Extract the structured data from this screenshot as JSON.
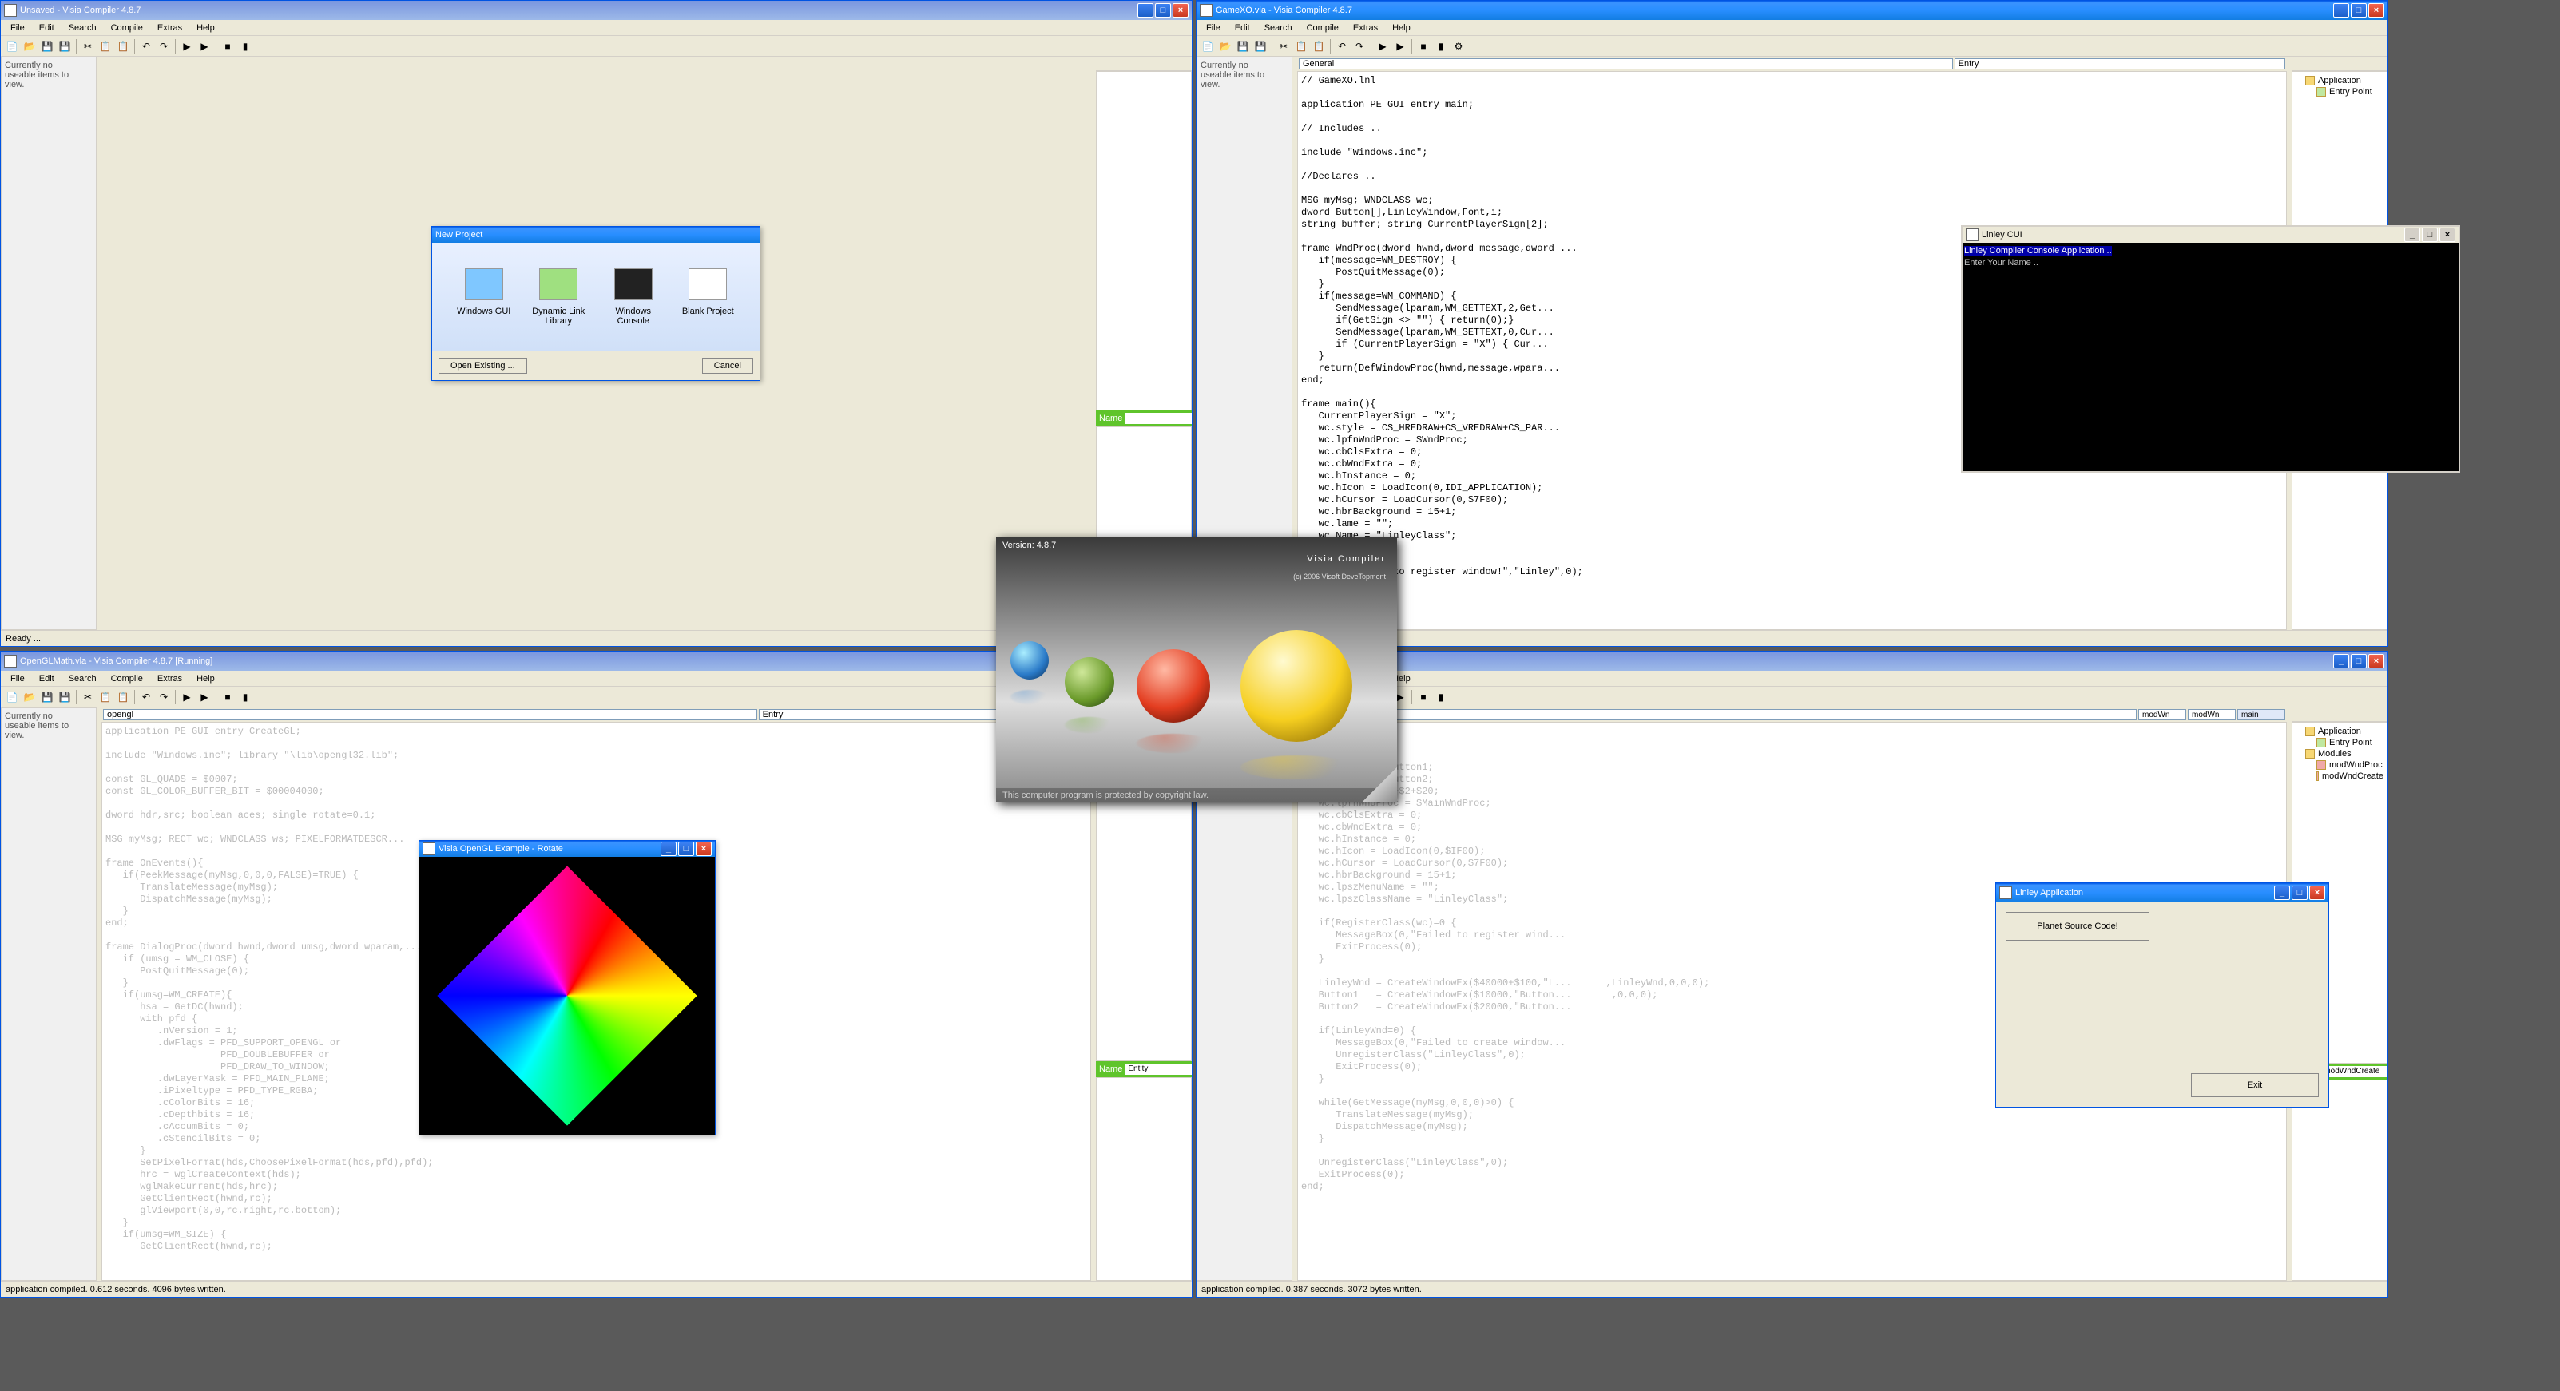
{
  "windows": {
    "w1": {
      "title": "Unsaved - Visia Compiler 4.8.7",
      "status": "Ready ..."
    },
    "w2": {
      "title": "GameXO.vla - Visia Compiler 4.8.7",
      "status": ""
    },
    "w3": {
      "title": "OpenGLMath.vla - Visia Compiler 4.8.7 [Running]",
      "status": "application compiled. 0.612 seconds. 4096 bytes written."
    },
    "w4": {
      "title": "",
      "status": "application compiled. 0.387 seconds. 3072 bytes written."
    }
  },
  "menu": [
    "File",
    "Edit",
    "Search",
    "Compile",
    "Extras",
    "Help"
  ],
  "leftpanel": "Currently no\nuseable items to\nview.",
  "combo": {
    "general": "General",
    "entry": "Entry"
  },
  "newproject": {
    "title": "New Project",
    "types": [
      "Windows GUI",
      "Dynamic Link Library",
      "Windows Console",
      "Blank Project"
    ],
    "open": "Open Existing ...",
    "cancel": "Cancel"
  },
  "console": {
    "title": "Linley CUI",
    "line1": "Linley Compiler Console Application ..",
    "line2": "Enter Your Name .."
  },
  "gl": {
    "title": "Visia OpenGL Example - Rotate"
  },
  "linley": {
    "title": "Linley Application",
    "btn1": "Planet Source Code!",
    "btn2": "Exit"
  },
  "splash": {
    "version": "Version: 4.8.7",
    "name": "Visia Compiler",
    "sub": "(c) 2006 Visoft DeveTopment",
    "foot": "This computer program is protected by copyright law."
  },
  "tree2": {
    "app": "Application",
    "ep": "Entry Point"
  },
  "tree4": {
    "app": "Application",
    "ep": "Entry Point",
    "mods": "Modules",
    "m1": "modWndProc",
    "m2": "modWndCreate"
  },
  "tabs4": [
    "modWn",
    "modWn",
    "main"
  ],
  "namebar": {
    "label": "Name",
    "val": "Entity"
  },
  "code2": "// GameXO.lnl\n\napplication PE GUI entry main;\n\n// Includes ..\n\ninclude \"Windows.inc\";\n\n//Declares ..\n\nMSG myMsg; WNDCLASS wc;\ndword Button[],LinleyWindow,Font,i;\nstring buffer; string CurrentPlayerSign[2];\n\nframe WndProc(dword hwnd,dword message,dword ...\n   if(message=WM_DESTROY) {\n      PostQuitMessage(0);\n   }\n   if(message=WM_COMMAND) {\n      SendMessage(lparam,WM_GETTEXT,2,Get...\n      if(GetSign <> \"\") { return(0);}\n      SendMessage(lparam,WM_SETTEXT,0,Cur...\n      if (CurrentPlayerSign = \"X\") { Cur...\n   }\n   return(DefWindowProc(hwnd,message,wpara...\nend;\n\nframe main(){\n   CurrentPlayerSign = \"X\";\n   wc.style = CS_HREDRAW+CS_VREDRAW+CS_PAR...\n   wc.lpfnWndProc = $WndProc;\n   wc.cbClsExtra = 0;\n   wc.cbWndExtra = 0;\n   wc.hInstance = 0;\n   wc.hIcon = LoadIcon(0,IDI_APPLICATION);\n   wc.hCursor = LoadCursor(0,$7F00);\n   wc.hbrBackground = 15+1;\n   wc.lame = \"\";\n   wc.Name = \"LinleyClass\";\n\n   lass(wc)=0) {\n   ox(0,\"Failed to register window!\",\"Linley\",0);\n   ess(0);",
  "code3": "application PE GUI entry CreateGL;\n\ninclude \"Windows.inc\"; library \"\\lib\\opengl32.lib\";\n\nconst GL_QUADS = $0007;\nconst GL_COLOR_BUFFER_BIT = $00004000;\n\ndword hdr,src; boolean aces; single rotate=0.1;\n\nMSG myMsg; RECT wc; WNDCLASS ws; PIXELFORMATDESCR...\n\nframe OnEvents(){\n   if(PeekMessage(myMsg,0,0,0,FALSE)=TRUE) {\n      TranslateMessage(myMsg);\n      DispatchMessage(myMsg);\n   }\nend;\n\nframe DialogProc(dword hwnd,dword umsg,dword wparam,...\n   if (umsg = WM_CLOSE) {\n      PostQuitMessage(0);\n   }\n   if(umsg=WM_CREATE){\n      hsa = GetDC(hwnd);\n      with pfd {\n         .nVersion = 1;\n         .dwFlags = PFD_SUPPORT_OPENGL or\n                    PFD_DOUBLEBUFFER or\n                    PFD_DRAW_TO_WINDOW;\n         .dwLayerMask = PFD_MAIN_PLANE;\n         .iPixeltype = PFD_TYPE_RGBA;\n         .cColorBits = 16;\n         .cDepthbits = 16;\n         .cAccumBits = 0;\n         .cStencilBits = 0;\n      }\n      SetPixelFormat(hds,ChoosePixelFormat(hds,pfd),pfd);\n      hrc = wglCreateContext(hds);\n      wglMakeCurrent(hds,hrc);\n      GetClientRect(hwnd,rc);\n      glViewport(0,0,rc.right,rc.bottom);\n   }\n   if(umsg=WM_SIZE) {\n      GetClientRect(hwnd,rc);",
  "code4": "alog;\n\n   LinleyWnd;\n   lpcal dword Button1;\n   local dword Button2;\n   wc.style = $1+$2+$20;\n   wc.lpfnWndProc = $MainWndProc;\n   wc.cbClsExtra = 0;\n   wc.cbWndExtra = 0;\n   wc.hInstance = 0;\n   wc.hIcon = LoadIcon(0,$IF00);\n   wc.hCursor = LoadCursor(0,$7F00);\n   wc.hbrBackground = 15+1;\n   wc.lpszMenuName = \"\";\n   wc.lpszClassName = \"LinleyClass\";\n\n   if(RegisterClass(wc)=0 {\n      MessageBox(0,\"Failed to register wind...\n      ExitProcess(0);\n   }\n\n   LinleyWnd = CreateWindowEx($40000+$100,\"L...      ,LinleyWnd,0,0,0);\n   Button1   = CreateWindowEx($10000,\"Button...       ,0,0,0);\n   Button2   = CreateWindowEx($20000,\"Button...\n\n   if(LinleyWnd=0) {\n      MessageBox(0,\"Failed to create window...\n      UnregisterClass(\"LinleyClass\",0);\n      ExitProcess(0);\n   }\n\n   while(GetMessage(myMsg,0,0,0)>0) {\n      TranslateMessage(myMsg);\n      DispatchMessage(myMsg);\n   }\n\n   UnregisterClass(\"LinleyClass\",0);\n   ExitProcess(0);\nend;"
}
